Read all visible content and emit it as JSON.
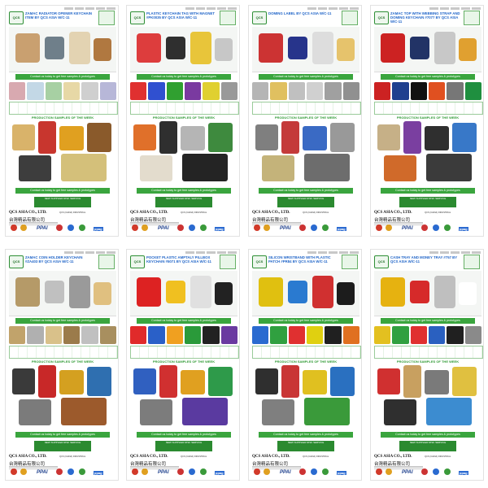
{
  "pages": [
    {
      "title": "ZAMAC RADIATOR OPENER KEYCHAIN ITEM BY QCS ASIA W/C-11",
      "hero": [
        "#c9a070",
        "#6f7f8a",
        "#e3d3b2",
        "#b07840"
      ],
      "colors": [
        "#d8a9b0",
        "#c3d8e6",
        "#a7d0a3",
        "#e7d8a6",
        "#cfcfcf",
        "#b7b7d8"
      ],
      "gallery": [
        "#d9b36a",
        "#c8362e",
        "#e0a020",
        "#8a5a2b",
        "#3d3d3d",
        "#d4c07a"
      ]
    },
    {
      "title": "PLASTIC KEYCHAIN TAG WITH MAGNET #PK0035 BY QCS ASIA W/C-11",
      "hero": [
        "#dd3d3d",
        "#2f2f2f",
        "#e8c53a",
        "#c7c7c7"
      ],
      "colors": [
        "#e03030",
        "#3050d0",
        "#30a030",
        "#7a3aa0",
        "#e0d030",
        "#999999"
      ],
      "gallery": [
        "#e0702a",
        "#2f2f2f",
        "#b5b5b5",
        "#3e8a3e",
        "#e3dccd",
        "#242424"
      ]
    },
    {
      "title": "DOMING LABEL BY QCS ASIA W/C-11",
      "hero": [
        "#c33",
        "#27348b",
        "#ddd",
        "#e6c36c"
      ],
      "colors": [
        "#b5b5b5",
        "#e0c060",
        "#c0c0c0",
        "#d0d0d0",
        "#a0a0a0",
        "#909090"
      ],
      "gallery": [
        "#7f7f7f",
        "#c43a3a",
        "#3a6ac4",
        "#999999",
        "#c4b37a",
        "#6d6d6d"
      ]
    },
    {
      "title": "ZAMAC TOP WITH WEBBING STRAP AND DOMING KEYCHAIN #7077 BY QCS ASIA W/C-11",
      "hero": [
        "#c22",
        "#223366",
        "#c8c8c8",
        "#e0a030"
      ],
      "colors": [
        "#cc2222",
        "#1f3f8f",
        "#111111",
        "#e05020",
        "#777777",
        "#1f8f3f"
      ],
      "gallery": [
        "#c6b087",
        "#7a3fa0",
        "#2f2f2f",
        "#3878c8",
        "#d06a2a",
        "#3b3b3b"
      ]
    },
    {
      "title": "ZAMAC COIN HOLDER KEYCHAIN #ZA403 BY QCS ASIA W/C-11",
      "hero": [
        "#b59a68",
        "#c0c0c0",
        "#9a9a9a",
        "#e0c080"
      ],
      "colors": [
        "#c1a36b",
        "#b0b0b0",
        "#d9c18a",
        "#9b7b4b",
        "#c0c0c0",
        "#a88f5f"
      ],
      "gallery": [
        "#3a3a3a",
        "#c82828",
        "#d4a020",
        "#2f6fb0",
        "#7b7b7b",
        "#9c5a2c"
      ]
    },
    {
      "title": "POCKET PLASTIC AMPTALY PILLBOX KEYCHAIN #5071 BY QCS ASIA W/C-11",
      "hero": [
        "#d22",
        "#f0c020",
        "#e0e0e0",
        "#222"
      ],
      "colors": [
        "#e02a2a",
        "#2a60c8",
        "#f0a020",
        "#2a9a3a",
        "#222222",
        "#6a3aa0"
      ],
      "gallery": [
        "#3060c0",
        "#d03030",
        "#e0a020",
        "#2e9a4a",
        "#7c7c7c",
        "#5a3aa0"
      ]
    },
    {
      "title": "SILICON WRISTBAND WITH PLASTIC PATCH #PR84 BY QCS ASIA W/C-11",
      "hero": [
        "#e0c010",
        "#2a7ad0",
        "#d03030",
        "#1c1c1c"
      ],
      "colors": [
        "#2a6ad0",
        "#30a040",
        "#e03030",
        "#e0d010",
        "#202020",
        "#e07020"
      ],
      "gallery": [
        "#2f2f2f",
        "#c93535",
        "#e0c020",
        "#2a70c0",
        "#7f7f7f",
        "#3a9a3a"
      ]
    },
    {
      "title": "CASH TRAY AND MONEY TRAY #757 BY QCS ASIA W/C-11",
      "hero": [
        "#e6b210",
        "#d62a2a",
        "#bfbfbf",
        "#ffffff"
      ],
      "colors": [
        "#e3c020",
        "#30a040",
        "#e03030",
        "#2a60c0",
        "#202020",
        "#8a8a8a"
      ],
      "gallery": [
        "#d03030",
        "#c8a060",
        "#7a7a7a",
        "#e0c040",
        "#2f2f2f",
        "#3c8cd0"
      ]
    }
  ],
  "common": {
    "banner": "Contact us today to get free samples & prototypes",
    "section": "PRODUCTION SAMPLES OF THE WEEK",
    "service": "NEW SUPPLIER RISK SERVICE",
    "company_en": "QCS ASIA CO., LTD.",
    "company_cn": "台灣精品有限公司",
    "industrial": "QCS (CHINA) INDUSTRIAL",
    "ppai": "PPAI",
    "ppag": "ppag",
    "logo": "QCS"
  }
}
